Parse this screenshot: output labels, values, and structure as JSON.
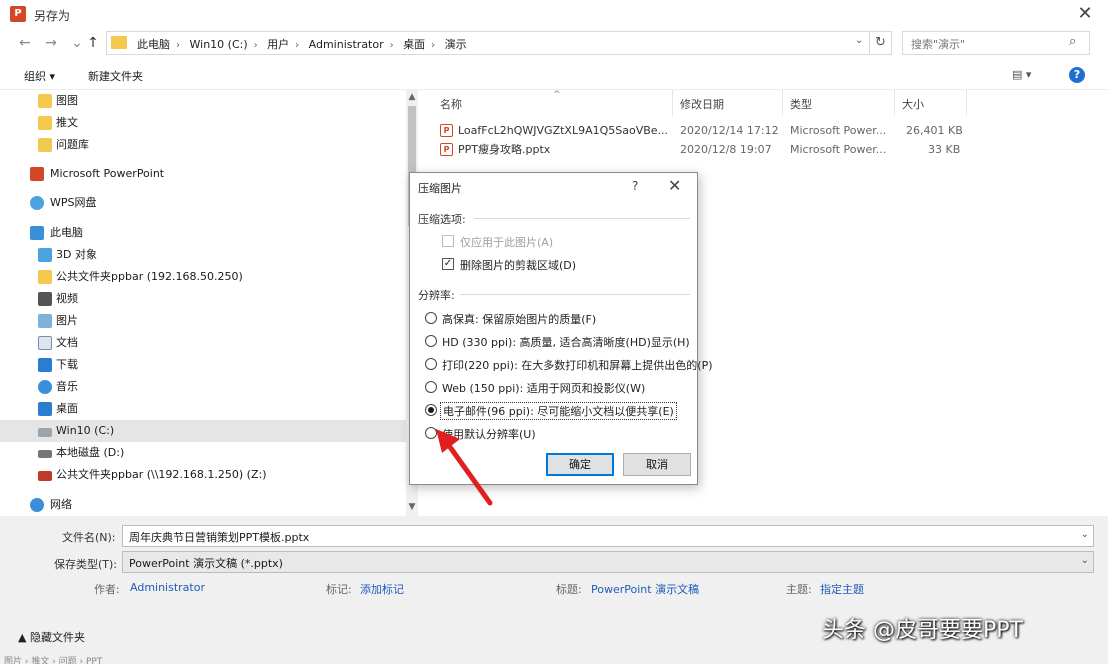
{
  "window": {
    "title": "另存为",
    "app_icon": "powerpoint-icon",
    "close_glyph": "✕"
  },
  "nav": {
    "back": "←",
    "forward": "→",
    "up": "↑"
  },
  "address": {
    "crumbs": [
      "此电脑",
      "Win10 (C:)",
      "用户",
      "Administrator",
      "桌面",
      "演示"
    ],
    "sep": "›",
    "dropdown": "⌄",
    "refresh": "↻"
  },
  "search": {
    "placeholder": "搜索\"演示\"",
    "icon": "🔍"
  },
  "toolbar": {
    "organize": "组织 ▾",
    "new_folder": "新建文件夹",
    "view": "▤ ▾",
    "help": "?"
  },
  "sidebar": {
    "items": [
      {
        "label": "图图",
        "icon": "folder-icon"
      },
      {
        "label": "推文",
        "icon": "folder-icon"
      },
      {
        "label": "问题库",
        "icon": "folder-icon"
      },
      {
        "label": "Microsoft PowerPoint",
        "icon": "powerpoint-icon"
      },
      {
        "label": "WPS网盘",
        "icon": "cloud-icon"
      },
      {
        "label": "此电脑",
        "icon": "computer-icon"
      },
      {
        "label": "3D 对象",
        "icon": "cube-icon"
      },
      {
        "label": "公共文件夹ppbar (192.168.50.250)",
        "icon": "network-folder-icon"
      },
      {
        "label": "视频",
        "icon": "video-icon"
      },
      {
        "label": "图片",
        "icon": "image-icon"
      },
      {
        "label": "文档",
        "icon": "document-icon"
      },
      {
        "label": "下载",
        "icon": "download-icon"
      },
      {
        "label": "音乐",
        "icon": "music-icon"
      },
      {
        "label": "桌面",
        "icon": "desktop-icon"
      },
      {
        "label": "Win10 (C:)",
        "icon": "drive-icon",
        "selected": true
      },
      {
        "label": "本地磁盘 (D:)",
        "icon": "drive-icon"
      },
      {
        "label": "公共文件夹ppbar (\\\\192.168.1.250) (Z:)",
        "icon": "network-drive-icon"
      },
      {
        "label": "网络",
        "icon": "network-icon"
      }
    ]
  },
  "files": {
    "columns": {
      "name": "名称",
      "date": "修改日期",
      "type": "类型",
      "size": "大小"
    },
    "rows": [
      {
        "name": "LoafFcL2hQWJVGZtXL9A1Q5SaoVBe...",
        "date": "2020/12/14 17:12",
        "type": "Microsoft Power...",
        "size": "26,401 KB"
      },
      {
        "name": "PPT瘦身攻略.pptx",
        "date": "2020/12/8 19:07",
        "type": "Microsoft Power...",
        "size": "33 KB"
      }
    ]
  },
  "bottom": {
    "filename_label": "文件名(N):",
    "filename_value": "周年庆典节日营销策划PPT模板.pptx",
    "savetype_label": "保存类型(T):",
    "savetype_value": "PowerPoint 演示文稿 (*.pptx)",
    "author_label": "作者:",
    "author_value": "Administrator",
    "tags_label": "标记:",
    "tags_value": "添加标记",
    "title_label": "标题:",
    "title_value": "PowerPoint 演示文稿",
    "subject_label": "主题:",
    "subject_value": "指定主题",
    "hide_folders": "▲ 隐藏文件夹",
    "status": "图片 › 推文 › 问题 › PPT"
  },
  "dialog": {
    "title": "压缩图片",
    "help": "?",
    "close": "✕",
    "section_options": "压缩选项:",
    "opt_only_this": "仅应用于此图片(A)",
    "opt_delete_crop": "删除图片的剪裁区域(D)",
    "section_resolution": "分辨率:",
    "res_options": [
      {
        "label": "高保真: 保留原始图片的质量(F)",
        "selected": false
      },
      {
        "label": "HD (330 ppi): 高质量, 适合高清晰度(HD)显示(H)",
        "selected": false
      },
      {
        "label": "打印(220 ppi): 在大多数打印机和屏幕上提供出色的(P)",
        "selected": false
      },
      {
        "label": "Web (150 ppi): 适用于网页和投影仪(W)",
        "selected": false
      },
      {
        "label": "电子邮件(96 ppi): 尽可能缩小文档以便共享(E)",
        "selected": true
      },
      {
        "label": "使用默认分辨率(U)",
        "selected": false
      }
    ],
    "ok": "确定",
    "cancel": "取消"
  },
  "watermark": "头条 @皮哥要要PPT",
  "colors": {
    "accent": "#1f6fd1",
    "arrow": "#e02020",
    "link": "#1f5bb8"
  }
}
